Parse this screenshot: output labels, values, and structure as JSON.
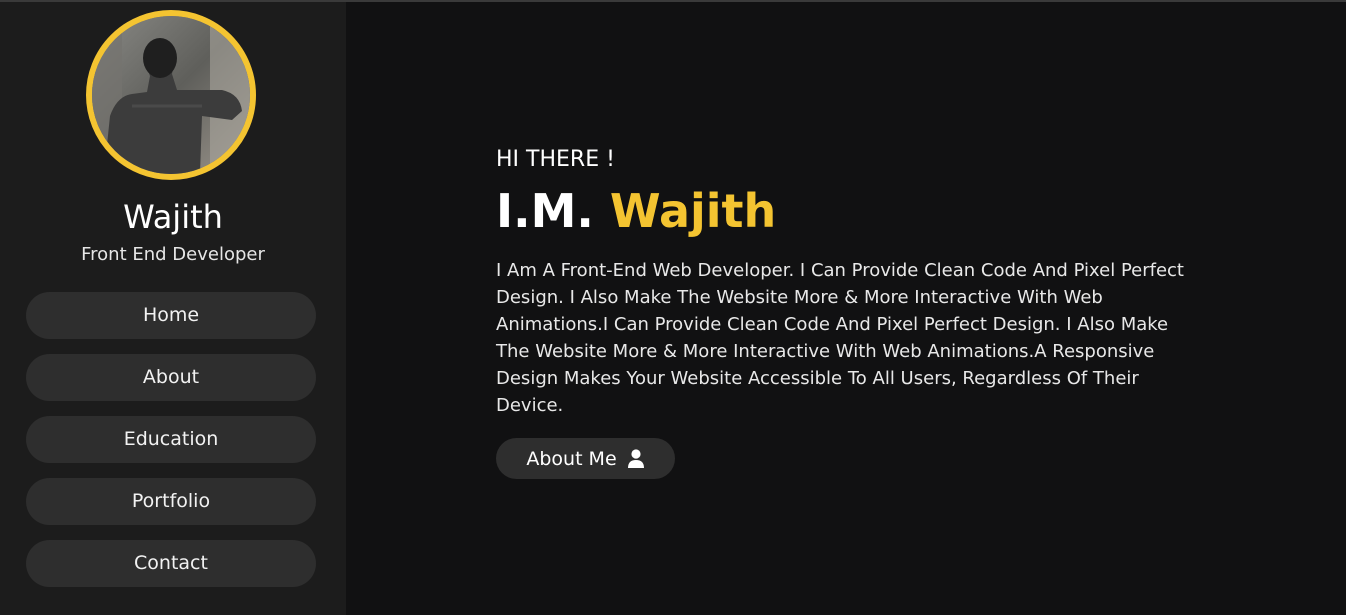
{
  "profile": {
    "name": "Wajith",
    "role": "Front End Developer"
  },
  "nav": {
    "items": [
      {
        "label": "Home"
      },
      {
        "label": "About"
      },
      {
        "label": "Education"
      },
      {
        "label": "Portfolio"
      },
      {
        "label": "Contact"
      }
    ]
  },
  "hero": {
    "greeting": "HI THERE !",
    "prefix": "I.M.",
    "highlight": "Wajith",
    "description": "I Am A Front-End Web Developer. I Can Provide Clean Code And Pixel Perfect Design. I Also Make The Website More & More Interactive With Web Animations.I Can Provide Clean Code And Pixel Perfect Design. I Also Make The Website More & More Interactive With Web Animations.A Responsive Design Makes Your Website Accessible To All Users, Regardless Of Their Device.",
    "button_label": "About Me",
    "button_icon": "user-icon"
  },
  "colors": {
    "accent": "#f4c431",
    "sidebar_bg": "#1c1c1c",
    "main_bg": "#111112",
    "button_bg": "#2e2e2e"
  }
}
